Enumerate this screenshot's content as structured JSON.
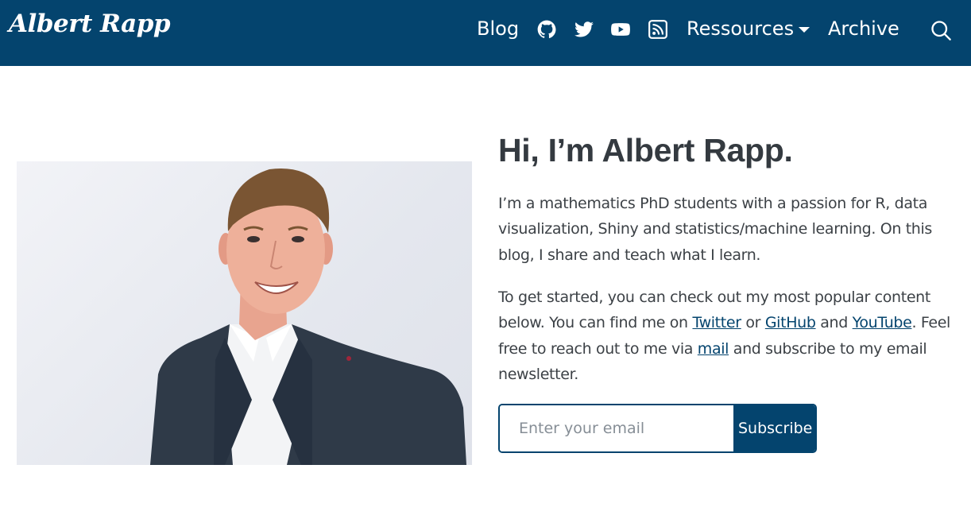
{
  "nav": {
    "brand": "Albert Rapp",
    "blog": "Blog",
    "icons": [
      "github-icon",
      "twitter-icon",
      "youtube-icon",
      "rss-icon",
      "search-icon"
    ],
    "ressources": "Ressources",
    "archive": "Archive"
  },
  "hero": {
    "title": "Hi, I’m Albert Rapp.",
    "intro": "I’m a mathematics PhD students with a passion for R, data visualization, Shiny and statistics/machine learning. On this blog, I share and teach what I learn.",
    "cta_before": "To get started, you can check out my most popular content below. You can find me on ",
    "twitter": "Twitter",
    "or": " or ",
    "github": "GitHub",
    "and": " and ",
    "youtube": "YouTube",
    "feel_free": ". Feel free to reach out to me via ",
    "mail": "mail",
    "cta_after": " and subscribe to my email newsletter."
  },
  "newsletter": {
    "placeholder": "Enter your email",
    "button": "Subscribe"
  },
  "colors": {
    "brand": "#04446e",
    "text": "#343a40"
  }
}
